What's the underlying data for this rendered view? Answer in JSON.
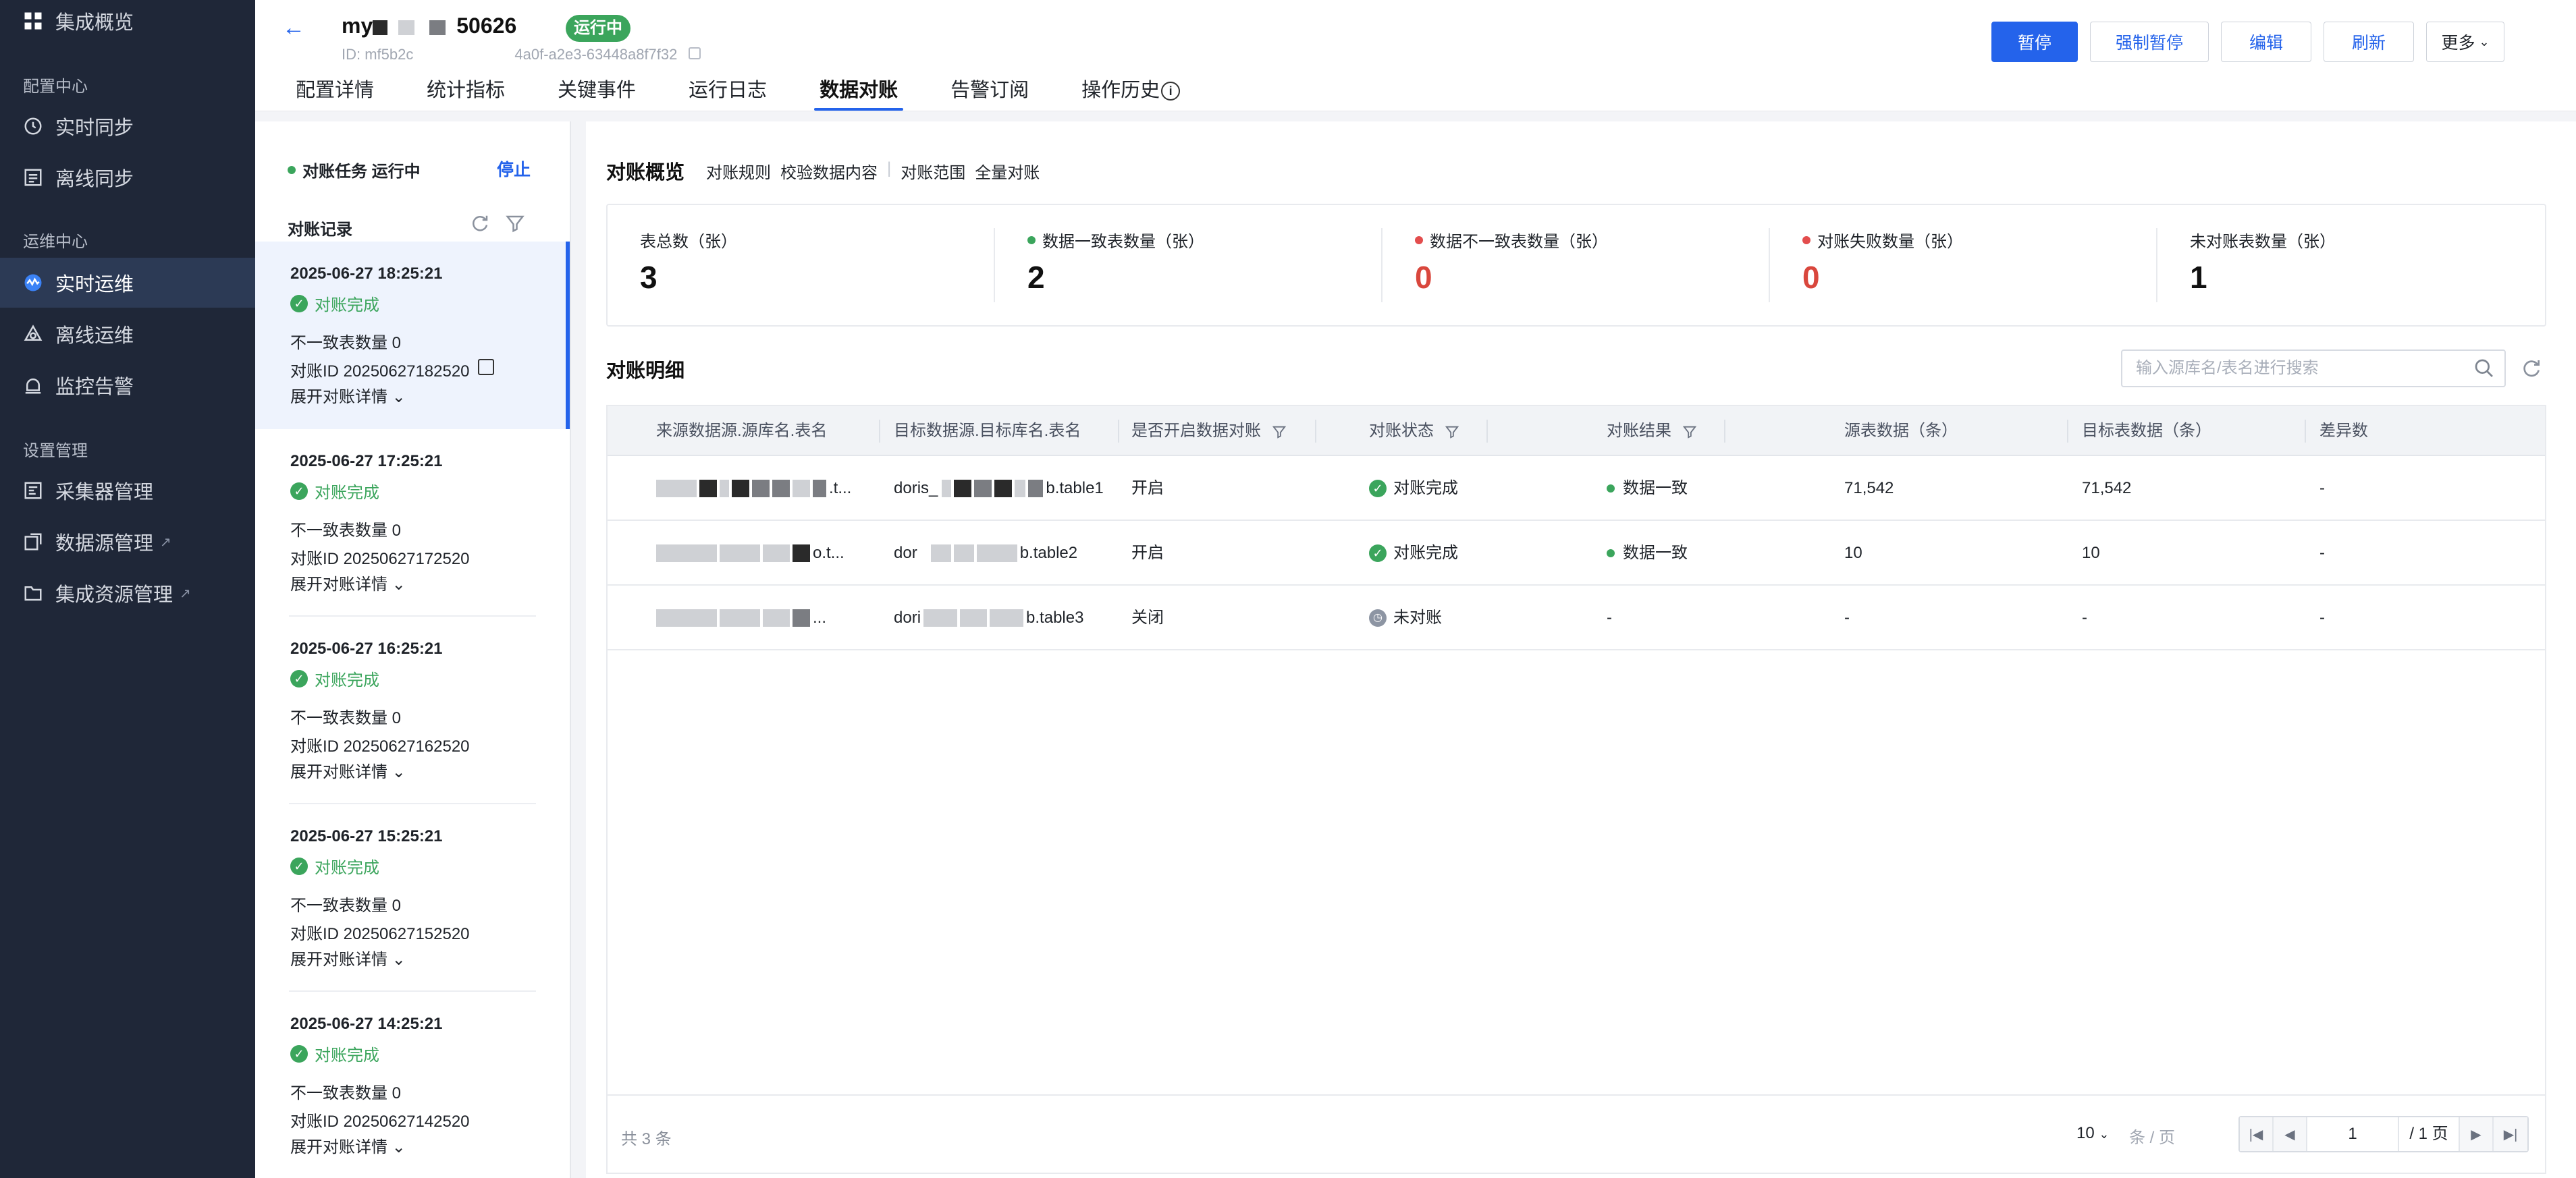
{
  "sidebar": {
    "top_item": "集成概览",
    "group_config": "配置中心",
    "realtime_sync": "实时同步",
    "offline_sync": "离线同步",
    "group_ops": "运维中心",
    "realtime_ops": "实时运维",
    "offline_ops": "离线运维",
    "monitor_alert": "监控告警",
    "group_settings": "设置管理",
    "collector_mgmt": "采集器管理",
    "datasource_mgmt": "数据源管理",
    "resource_mgmt": "集成资源管理"
  },
  "header": {
    "title_prefix": "my",
    "title_suffix": "50626",
    "status": "运行中",
    "id_prefix": "ID: mf5b2c",
    "id_suffix": "4a0f-a2e3-63448a8f7f32",
    "buttons": {
      "pause": "暂停",
      "force_pause": "强制暂停",
      "edit": "编辑",
      "refresh": "刷新",
      "more": "更多"
    },
    "tabs": [
      "配置详情",
      "统计指标",
      "关键事件",
      "运行日志",
      "数据对账",
      "告警订阅",
      "操作历史"
    ]
  },
  "left": {
    "task_status": "对账任务 运行中",
    "stop": "停止",
    "records_title": "对账记录",
    "records": [
      {
        "time": "2025-06-27 18:25:21",
        "status": "对账完成",
        "inconsistent": "不一致表数量 0",
        "id": "对账ID 20250627182520",
        "expand": "展开对账详情"
      },
      {
        "time": "2025-06-27 17:25:21",
        "status": "对账完成",
        "inconsistent": "不一致表数量 0",
        "id": "对账ID 20250627172520",
        "expand": "展开对账详情"
      },
      {
        "time": "2025-06-27 16:25:21",
        "status": "对账完成",
        "inconsistent": "不一致表数量 0",
        "id": "对账ID 20250627162520",
        "expand": "展开对账详情"
      },
      {
        "time": "2025-06-27 15:25:21",
        "status": "对账完成",
        "inconsistent": "不一致表数量 0",
        "id": "对账ID 20250627152520",
        "expand": "展开对账详情"
      },
      {
        "time": "2025-06-27 14:25:21",
        "status": "对账完成",
        "inconsistent": "不一致表数量 0",
        "id": "对账ID 20250627142520",
        "expand": "展开对账详情"
      }
    ]
  },
  "main": {
    "overview_title": "对账概览",
    "links": [
      "对账规则",
      "校验数据内容",
      "对账范围",
      "全量对账"
    ],
    "summary": [
      {
        "label": "表总数（张）",
        "value": "3"
      },
      {
        "label": "数据一致表数量（张）",
        "value": "2"
      },
      {
        "label": "数据不一致表数量（张）",
        "value": "0"
      },
      {
        "label": "对账失败数量（张）",
        "value": "0"
      },
      {
        "label": "未对账表数量（张）",
        "value": "1"
      }
    ],
    "detail_title": "对账明细",
    "search_placeholder": "输入源库名/表名进行搜索",
    "columns": [
      "来源数据源.源库名.表名",
      "目标数据源.目标库名.表名",
      "是否开启数据对账",
      "对账状态",
      "对账结果",
      "源表数据（条）",
      "目标表数据（条）",
      "差异数"
    ],
    "rows": [
      {
        "src_tail": ".t...",
        "tgt_head": "doris_",
        "tgt_tail": "b.table1",
        "enabled": "开启",
        "status": "对账完成",
        "result": "数据一致",
        "src_count": "71,542",
        "tgt_count": "71,542",
        "diff": "-"
      },
      {
        "src_tail": "o.t...",
        "tgt_head": "dor",
        "tgt_tail": "b.table2",
        "enabled": "开启",
        "status": "对账完成",
        "result": "数据一致",
        "src_count": "10",
        "tgt_count": "10",
        "diff": "-"
      },
      {
        "src_tail": "...",
        "tgt_head": "dori",
        "tgt_tail": "b.table3",
        "enabled": "关闭",
        "status": "未对账",
        "result": "-",
        "src_count": "-",
        "tgt_count": "-",
        "diff": "-"
      }
    ],
    "footer": {
      "total": "共 3 条",
      "page_size": "10",
      "page_unit": "条 / 页",
      "page": "1",
      "page_total": "/ 1 页"
    }
  },
  "colors": {
    "accent": "#2463eb",
    "success": "#3ba55c",
    "danger": "#d9473d",
    "sidebar_bg": "#1f2738"
  }
}
